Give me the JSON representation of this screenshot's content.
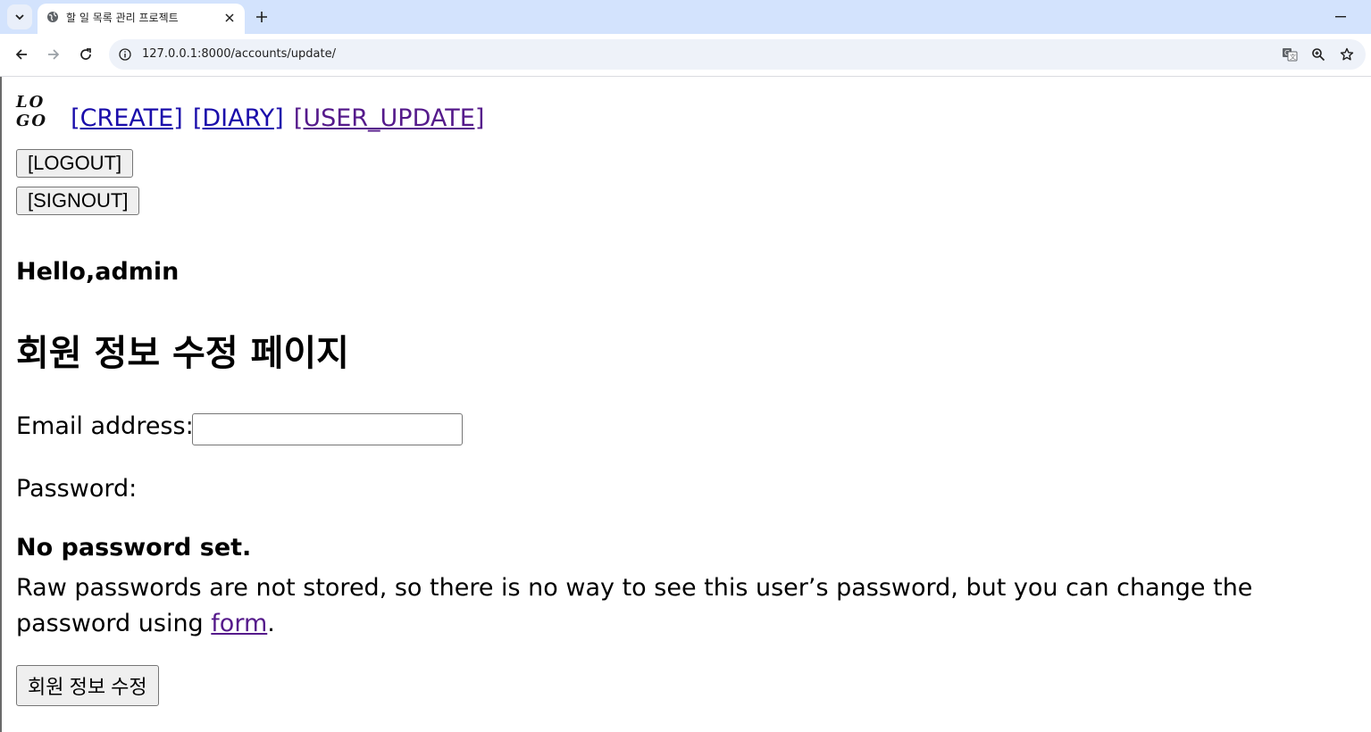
{
  "browser": {
    "tab_title": "할 일 목록 관리 프로젝트",
    "url": "127.0.0.1:8000/accounts/update/",
    "icons": {
      "tab_search": "chevron-down-icon",
      "favicon": "globe-icon",
      "close": "close-icon",
      "new_tab": "plus-icon",
      "minimize": "minimize-icon",
      "back": "back-arrow-icon",
      "forward": "forward-arrow-icon",
      "reload": "reload-icon",
      "site_info": "info-icon",
      "translate": "translate-icon",
      "zoom": "zoom-icon",
      "bookmark": "star-icon"
    }
  },
  "nav": {
    "logo_line1": "LO",
    "logo_line2": "GO",
    "links": [
      {
        "label": "[CREATE]"
      },
      {
        "label": "[DIARY]"
      },
      {
        "label": "[USER_UPDATE]"
      }
    ],
    "logout_label": "[LOGOUT]",
    "signout_label": "[SIGNOUT]"
  },
  "main": {
    "greeting": "Hello,admin",
    "title": "회원 정보 수정 페이지",
    "form": {
      "email_label": "Email address:",
      "email_value": "",
      "password_label": "Password:",
      "password_status": "No password set.",
      "password_help": "Raw passwords are not stored, so there is no way to see this user’s password, but you can change the password using",
      "password_help_link": "form",
      "password_help_end": ".",
      "submit_label": "회원 정보 수정"
    }
  },
  "colors": {
    "tabbar_bg": "#d3e3fd",
    "link": "#1a0dab",
    "visited_link": "#551a8b"
  }
}
